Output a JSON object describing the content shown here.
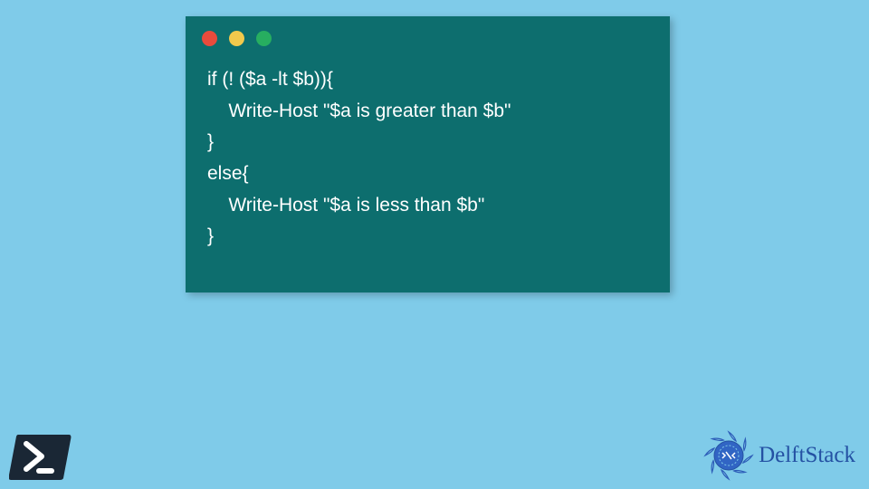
{
  "code": {
    "lines": [
      "if (! ($a -lt $b)){",
      "    Write-Host \"$a is greater than $b\"",
      "}",
      "else{",
      "    Write-Host \"$a is less than $b\"",
      "}"
    ]
  },
  "window": {
    "controls": [
      "red",
      "yellow",
      "green"
    ]
  },
  "brand": {
    "name": "DelftStack"
  },
  "icons": {
    "powershell": "powershell-icon",
    "brandmark": "delft-mandala-icon"
  },
  "colors": {
    "background": "#7fcbe9",
    "codeWindow": "#0d6e6e",
    "brand": "#2451a3",
    "psDark": "#1a1a1a",
    "dotRed": "#e94b3c",
    "dotYellow": "#f2c94c",
    "dotGreen": "#27ae60"
  }
}
